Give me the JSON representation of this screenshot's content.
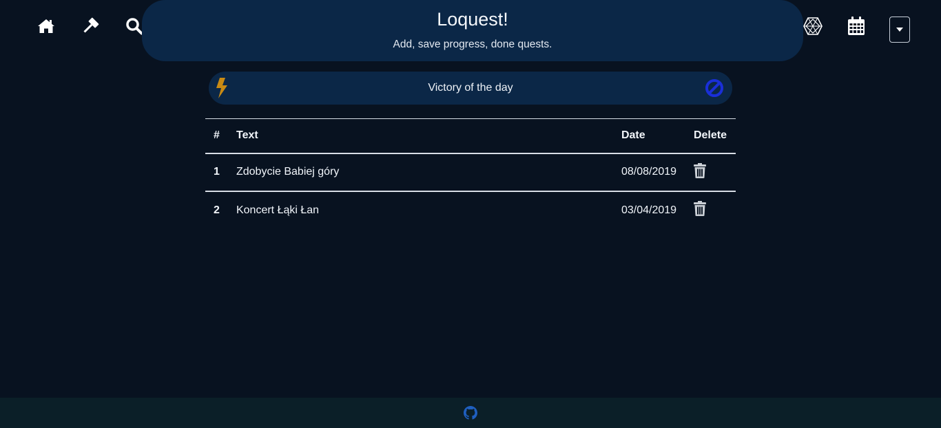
{
  "nav": {
    "left_icons": [
      "home-icon",
      "gavel-icon",
      "search-icon"
    ],
    "right_icons": [
      "hexagon-icon",
      "calendar-icon"
    ],
    "dropdown_icon": "caret-down-icon"
  },
  "header": {
    "title": "Loquest!",
    "subtitle": "Add, save progress, done quests."
  },
  "victory": {
    "label": "Victory of the day",
    "left_icon": "bolt-icon",
    "right_icon": "ban-icon",
    "bolt_color": "#c88a14",
    "ban_color": "#1a2fd8"
  },
  "table": {
    "headers": {
      "num": "#",
      "text": "Text",
      "date": "Date",
      "delete": "Delete"
    },
    "rows": [
      {
        "num": "1",
        "text": "Zdobycie Babiej góry",
        "date": "08/08/2019"
      },
      {
        "num": "2",
        "text": "Koncert Łąki Łan",
        "date": "03/04/2019"
      }
    ]
  },
  "footer": {
    "icon": "github-icon",
    "icon_color": "#1f5fbf"
  },
  "colors": {
    "background": "#081220",
    "panel": "#0b2747",
    "footer": "#0b1f28"
  }
}
